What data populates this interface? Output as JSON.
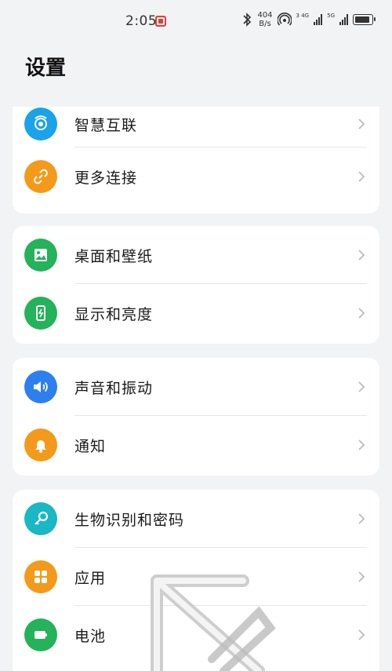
{
  "status_bar": {
    "time": "2:05",
    "net_speed_value": "404",
    "net_speed_unit": "B/s",
    "sim1_label": "3 4G",
    "sim2_label": "5G"
  },
  "page": {
    "title": "设置"
  },
  "groups": [
    {
      "items": [
        {
          "label": "智慧互联",
          "icon": "connect-icon",
          "color": "#1aa3e8"
        },
        {
          "label": "更多连接",
          "icon": "link-icon",
          "color": "#f39a1b"
        }
      ]
    },
    {
      "items": [
        {
          "label": "桌面和壁纸",
          "icon": "wallpaper-icon",
          "color": "#24b25a"
        },
        {
          "label": "显示和亮度",
          "icon": "display-icon",
          "color": "#24b25a"
        }
      ]
    },
    {
      "items": [
        {
          "label": "声音和振动",
          "icon": "sound-icon",
          "color": "#2d7ff0"
        },
        {
          "label": "通知",
          "icon": "bell-icon",
          "color": "#f39a1b"
        }
      ]
    },
    {
      "items": [
        {
          "label": "生物识别和密码",
          "icon": "key-icon",
          "color": "#1ab7c4"
        },
        {
          "label": "应用",
          "icon": "apps-icon",
          "color": "#f39a1b"
        },
        {
          "label": "电池",
          "icon": "battery-icon",
          "color": "#24b25a"
        }
      ]
    }
  ]
}
